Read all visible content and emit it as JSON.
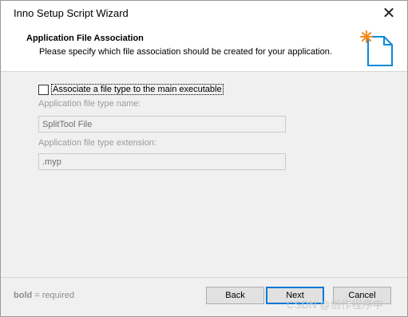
{
  "window": {
    "title": "Inno Setup Script Wizard",
    "close_glyph": "✕"
  },
  "header": {
    "title": "Application File Association",
    "subtitle": "Please specify which file association should be created for your application.",
    "icon": "document-sparkle-icon",
    "accent_color": "#0a8bd6",
    "sparkle_color": "#f18a1e"
  },
  "form": {
    "associate_checkbox": {
      "label": "Associate a file type to the main executable",
      "checked": false
    },
    "type_name": {
      "label": "Application file type name:",
      "value": "SplitTool File"
    },
    "type_extension": {
      "label": "Application file type extension:",
      "value": ".myp"
    }
  },
  "footer": {
    "hint_bold": "bold",
    "hint_rest": " = required",
    "back_label": "Back",
    "next_label": "Next",
    "cancel_label": "Cancel"
  },
  "watermark": "CSDN @创作程序中"
}
